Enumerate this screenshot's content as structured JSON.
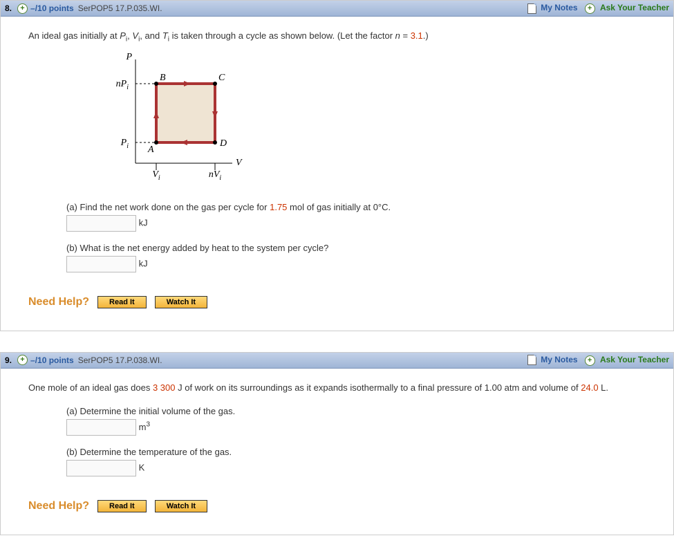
{
  "questions": [
    {
      "number": "8.",
      "points": "–/10 points",
      "source": "SerPOP5 17.P.035.WI.",
      "notes_label": "My Notes",
      "ask_label": "Ask Your Teacher",
      "intro_pre": "An ideal gas initially at ",
      "intro_pv": "P",
      "intro_comma1": ", ",
      "intro_vv": "V",
      "intro_comma2": ", and ",
      "intro_tv": "T",
      "intro_post": " is taken through a cycle as shown below. (Let the factor ",
      "intro_nlabel": "n",
      "intro_eq": " = ",
      "intro_nval": "3.1",
      "intro_end": ".)",
      "part_a_pre": "(a) Find the net work done on the gas per cycle for ",
      "part_a_val": "1.75",
      "part_a_post": " mol of gas initially at 0°C.",
      "unit_a": "kJ",
      "part_b_text": "(b) What is the net energy added by heat to the system per cycle?",
      "unit_b": "kJ",
      "need_help": "Need Help?",
      "read_it": "Read It",
      "watch_it": "Watch It",
      "diagram": {
        "P": "P",
        "V": "V",
        "nPi_n": "nP",
        "nPi_i": "i",
        "Pi_P": "P",
        "Pi_i": "i",
        "Vi_V": "V",
        "Vi_i": "i",
        "nVi_n": "nV",
        "nVi_i": "i",
        "A": "A",
        "B": "B",
        "C": "C",
        "D": "D"
      }
    },
    {
      "number": "9.",
      "points": "–/10 points",
      "source": "SerPOP5 17.P.038.WI.",
      "notes_label": "My Notes",
      "ask_label": "Ask Your Teacher",
      "intro_pre": "One mole of an ideal gas does ",
      "intro_work": "3 300",
      "intro_mid": " J of work on its surroundings as it expands isothermally to a final pressure of 1.00 atm and volume of ",
      "intro_vol": "24.0",
      "intro_end": " L.",
      "part_a_text": "(a) Determine the initial volume of the gas.",
      "unit_a_pre": "m",
      "unit_a_sup": "3",
      "part_b_text": "(b) Determine the temperature of the gas.",
      "unit_b": "K",
      "need_help": "Need Help?",
      "read_it": "Read It",
      "watch_it": "Watch It"
    }
  ]
}
